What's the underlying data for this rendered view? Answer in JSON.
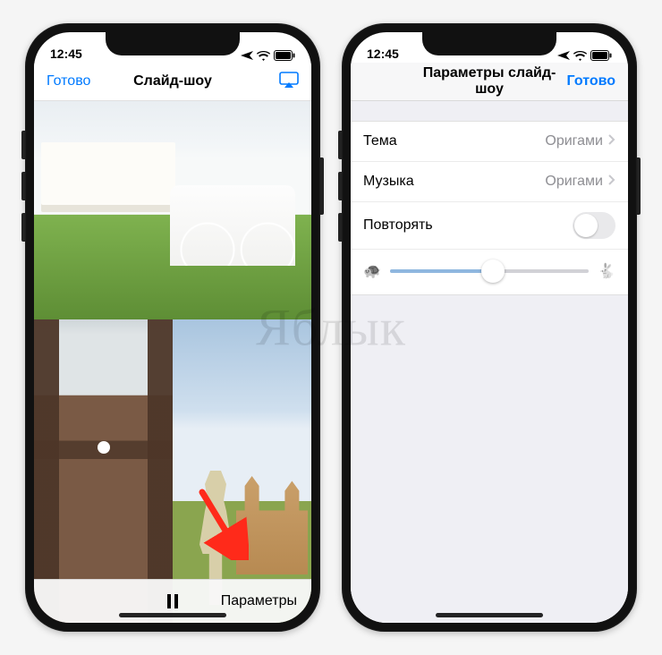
{
  "watermark": "Яблык",
  "statusbar": {
    "time": "12:45"
  },
  "left": {
    "nav": {
      "done": "Готово",
      "title": "Слайд-шоу"
    },
    "toolbar": {
      "options": "Параметры"
    }
  },
  "right": {
    "nav": {
      "title": "Параметры слайд-шоу",
      "done": "Готово"
    },
    "rows": {
      "theme": {
        "label": "Тема",
        "value": "Оригами"
      },
      "music": {
        "label": "Музыка",
        "value": "Оригами"
      },
      "repeat": {
        "label": "Повторять"
      }
    },
    "slider": {
      "slow": "🐢",
      "fast": "🐇",
      "value": 0.52
    }
  }
}
